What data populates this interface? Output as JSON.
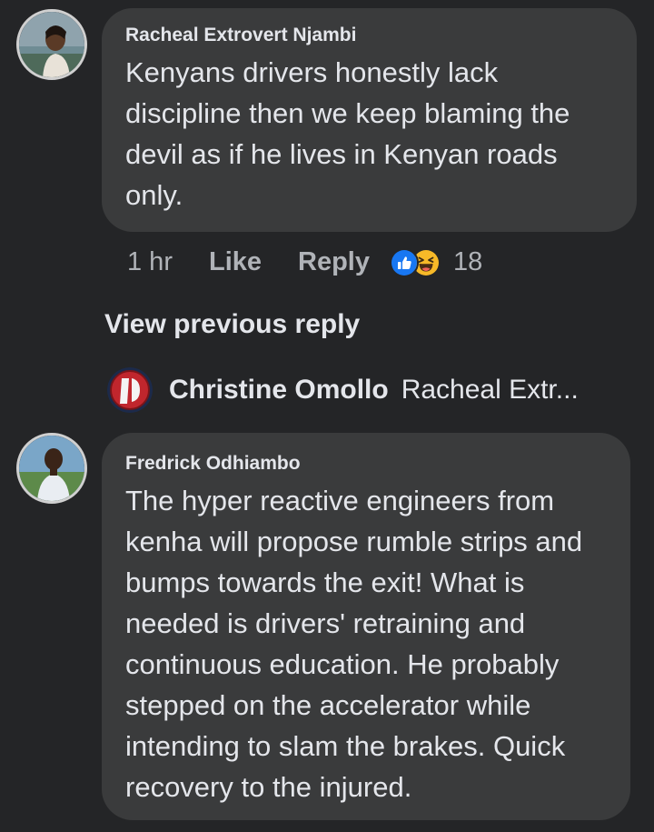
{
  "comments": [
    {
      "author": "Racheal Extrovert Njambi",
      "text": "Kenyans drivers honestly lack discipline then we keep blaming the devil as if he lives in Kenyan roads only.",
      "time": "1 hr",
      "like_label": "Like",
      "reply_label": "Reply",
      "reactions": [
        "like-icon",
        "haha-icon"
      ],
      "reaction_count": "18"
    },
    {
      "author": "Fredrick Odhiambo",
      "text": "The hyper reactive engineers from kenha will propose rumble strips and bumps towards the exit! What is needed is drivers' retraining and continuous education. He probably stepped on the accelerator while intending to slam the brakes. Quick recovery to the injured."
    }
  ],
  "view_previous_reply": "View previous reply",
  "reply_preview": {
    "author": "Christine Omollo",
    "text": "Racheal Extr..."
  },
  "colors": {
    "background": "#242527",
    "bubble": "#3a3b3c",
    "text_primary": "#e4e6eb",
    "text_secondary": "#b0b3b8",
    "like_blue": "#1877f2",
    "haha_yellow": "#f7b928"
  }
}
